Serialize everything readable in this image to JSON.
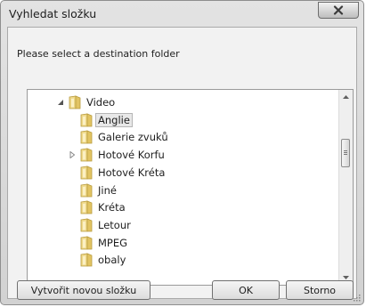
{
  "window": {
    "title": "Vyhledat složku",
    "close_glyph": "✕"
  },
  "prompt": "Please select a destination folder",
  "tree": {
    "rows": [
      {
        "label": "Video",
        "level": 0,
        "expander": "expanded",
        "selected": false
      },
      {
        "label": "Anglie",
        "level": 1,
        "expander": "none",
        "selected": true
      },
      {
        "label": "Galerie zvuků",
        "level": 1,
        "expander": "none",
        "selected": false
      },
      {
        "label": "Hotové Korfu",
        "level": 1,
        "expander": "collapsed",
        "selected": false
      },
      {
        "label": "Hotové Kréta",
        "level": 1,
        "expander": "none",
        "selected": false
      },
      {
        "label": "Jiné",
        "level": 1,
        "expander": "none",
        "selected": false
      },
      {
        "label": "Kréta",
        "level": 1,
        "expander": "none",
        "selected": false
      },
      {
        "label": "Letour",
        "level": 1,
        "expander": "none",
        "selected": false
      },
      {
        "label": "MPEG",
        "level": 1,
        "expander": "none",
        "selected": false
      },
      {
        "label": "obaly",
        "level": 1,
        "expander": "none",
        "selected": false
      }
    ]
  },
  "buttons": {
    "new_folder": "Vytvořit novou složku",
    "ok": "OK",
    "cancel": "Storno"
  },
  "icons": {
    "folder": "folder-icon",
    "expanded": "triangle-down-right-icon",
    "collapsed": "triangle-right-icon"
  }
}
